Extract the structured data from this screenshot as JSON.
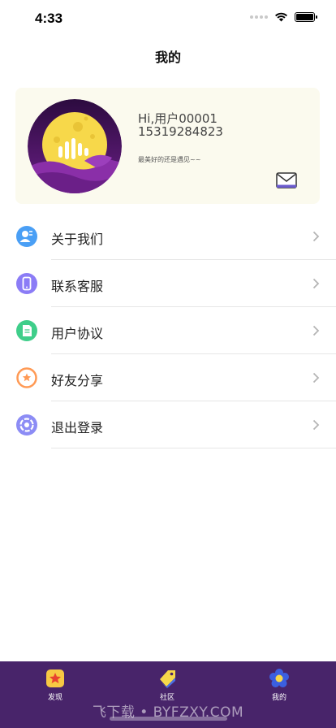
{
  "status_bar": {
    "time": "4:33",
    "battery_level": 1.0
  },
  "header": {
    "title": "我的"
  },
  "profile": {
    "greeting": "Hi,用户00001",
    "phone": "15319284823",
    "motto": "最美好的还是遇见~~"
  },
  "menu": {
    "items": [
      {
        "label": "关于我们",
        "icon": "about-us-icon",
        "color": "#4a9ff5"
      },
      {
        "label": "联系客服",
        "icon": "contact-service-icon",
        "color": "#8b7cf6"
      },
      {
        "label": "用户协议",
        "icon": "user-agreement-icon",
        "color": "#3fce8a"
      },
      {
        "label": "好友分享",
        "icon": "friend-share-icon",
        "color": "#ff9a55"
      },
      {
        "label": "退出登录",
        "icon": "logout-icon",
        "color": "#8c8cf5"
      }
    ]
  },
  "tab_bar": {
    "tabs": [
      {
        "label": "发现",
        "icon": "discover-icon"
      },
      {
        "label": "社区",
        "icon": "community-icon"
      },
      {
        "label": "我的",
        "icon": "mine-icon"
      }
    ],
    "background": "#48246a"
  },
  "watermark": "飞下载 • BYFZXY.COM"
}
